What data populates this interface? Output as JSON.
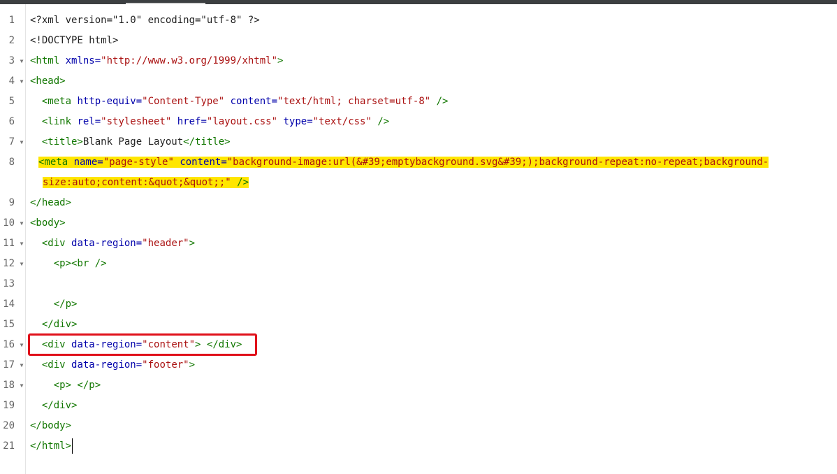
{
  "lines": [
    {
      "n": "1",
      "fold": "",
      "code": [
        {
          "c": "txt",
          "t": "<?xml version=\"1.0\" encoding=\"utf-8\" ?>"
        }
      ]
    },
    {
      "n": "2",
      "fold": "",
      "code": [
        {
          "c": "txt",
          "t": "<!DOCTYPE html>"
        }
      ]
    },
    {
      "n": "3",
      "fold": "▼",
      "code": [
        {
          "c": "tag",
          "t": "<html "
        },
        {
          "c": "attr",
          "t": "xmlns="
        },
        {
          "c": "val",
          "t": "\"http://www.w3.org/1999/xhtml\""
        },
        {
          "c": "tag",
          "t": ">"
        }
      ]
    },
    {
      "n": "4",
      "fold": "▼",
      "code": [
        {
          "c": "tag",
          "t": "<head>"
        }
      ]
    },
    {
      "n": "5",
      "fold": "",
      "code": [
        {
          "c": "tag",
          "t": "  <meta "
        },
        {
          "c": "attr",
          "t": "http-equiv="
        },
        {
          "c": "val",
          "t": "\"Content-Type\""
        },
        {
          "c": "attr",
          "t": " content="
        },
        {
          "c": "val",
          "t": "\"text/html; charset=utf-8\""
        },
        {
          "c": "tag",
          "t": " />"
        }
      ]
    },
    {
      "n": "6",
      "fold": "",
      "code": [
        {
          "c": "tag",
          "t": "  <link "
        },
        {
          "c": "attr",
          "t": "rel="
        },
        {
          "c": "val",
          "t": "\"stylesheet\""
        },
        {
          "c": "attr",
          "t": " href="
        },
        {
          "c": "val",
          "t": "\"layout.css\""
        },
        {
          "c": "attr",
          "t": " type="
        },
        {
          "c": "val",
          "t": "\"text/css\""
        },
        {
          "c": "tag",
          "t": " />"
        }
      ]
    },
    {
      "n": "7",
      "fold": "▼",
      "code": [
        {
          "c": "tag",
          "t": "  <title>"
        },
        {
          "c": "txt",
          "t": "Blank Page Layout"
        },
        {
          "c": "tag",
          "t": "</title>"
        }
      ]
    },
    {
      "n": "8",
      "fold": "",
      "wrap": true,
      "code": [
        {
          "c": "tag",
          "t": "<meta "
        },
        {
          "c": "attr",
          "t": "name="
        },
        {
          "c": "val",
          "t": "\"page-style\""
        },
        {
          "c": "attr",
          "t": " content="
        },
        {
          "c": "val",
          "t": "\"background-image:url(&#39;emptybackground.svg&#39;);background-repeat:no-repeat;background-"
        }
      ],
      "code2": [
        {
          "c": "val",
          "t": "size:auto;content:&quot;&quot;;\""
        },
        {
          "c": "tag",
          "t": " />"
        }
      ]
    },
    {
      "n": "9",
      "fold": "",
      "code": [
        {
          "c": "tag",
          "t": "</head>"
        }
      ]
    },
    {
      "n": "10",
      "fold": "▼",
      "code": [
        {
          "c": "tag",
          "t": "<body>"
        }
      ]
    },
    {
      "n": "11",
      "fold": "▼",
      "code": [
        {
          "c": "tag",
          "t": "  <div "
        },
        {
          "c": "attr",
          "t": "data-region="
        },
        {
          "c": "val",
          "t": "\"header\""
        },
        {
          "c": "tag",
          "t": ">"
        }
      ]
    },
    {
      "n": "12",
      "fold": "▼",
      "code": [
        {
          "c": "tag",
          "t": "    <p><br />"
        }
      ]
    },
    {
      "n": "13",
      "fold": "",
      "code": [
        {
          "c": "txt",
          "t": ""
        }
      ]
    },
    {
      "n": "14",
      "fold": "",
      "code": [
        {
          "c": "tag",
          "t": "    </p>"
        }
      ]
    },
    {
      "n": "15",
      "fold": "",
      "code": [
        {
          "c": "tag",
          "t": "  </div>"
        }
      ]
    },
    {
      "n": "16",
      "fold": "▼",
      "code": [
        {
          "c": "tag",
          "t": "  <div "
        },
        {
          "c": "attr",
          "t": "data-region="
        },
        {
          "c": "val",
          "t": "\"content\""
        },
        {
          "c": "tag",
          "t": "> </div>"
        }
      ]
    },
    {
      "n": "17",
      "fold": "▼",
      "code": [
        {
          "c": "tag",
          "t": "  <div "
        },
        {
          "c": "attr",
          "t": "data-region="
        },
        {
          "c": "val",
          "t": "\"footer\""
        },
        {
          "c": "tag",
          "t": ">"
        }
      ]
    },
    {
      "n": "18",
      "fold": "▼",
      "code": [
        {
          "c": "tag",
          "t": "    <p> </p>"
        }
      ]
    },
    {
      "n": "19",
      "fold": "",
      "code": [
        {
          "c": "tag",
          "t": "  </div>"
        }
      ]
    },
    {
      "n": "20",
      "fold": "",
      "code": [
        {
          "c": "tag",
          "t": "</body>"
        }
      ]
    },
    {
      "n": "21",
      "fold": "",
      "code": [
        {
          "c": "tag",
          "t": "</html>"
        }
      ],
      "cursor": true
    }
  ],
  "colors": {
    "tag": "#117700",
    "attribute": "#0000aa",
    "value": "#aa1111",
    "highlight": "#ffe600",
    "annotation_box": "#e0101a"
  }
}
